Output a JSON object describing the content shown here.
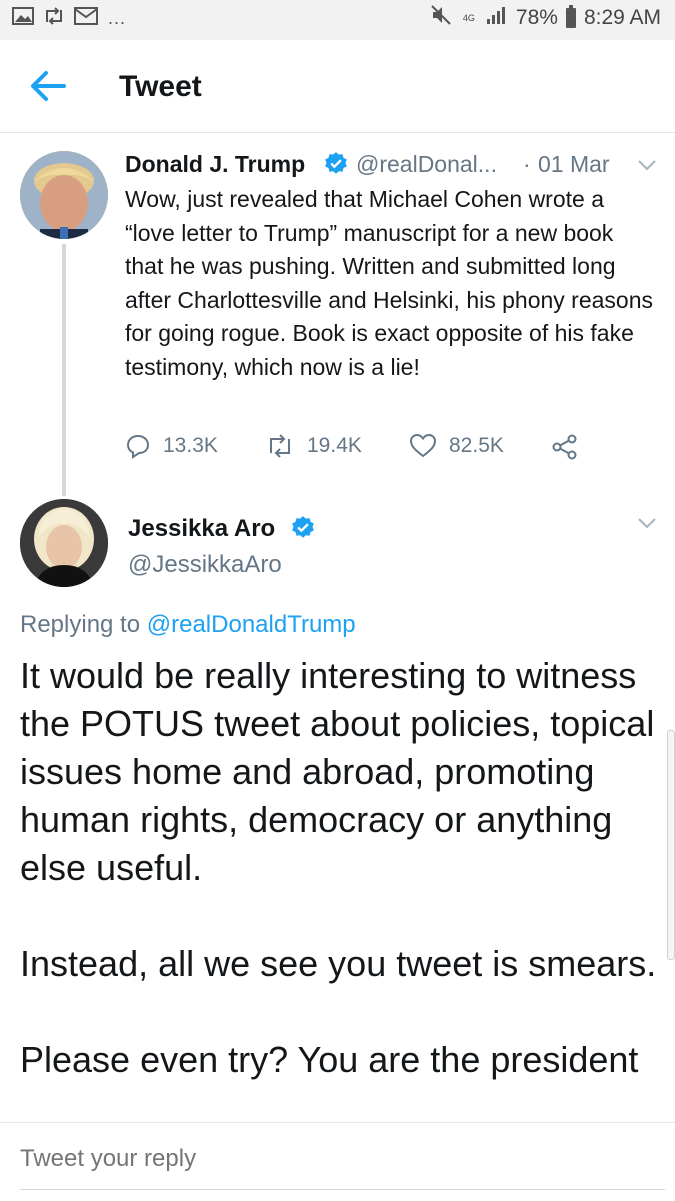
{
  "status_bar": {
    "left_icons": [
      "image-icon",
      "retweet-icon",
      "mail-icon"
    ],
    "more": "...",
    "network": "4G",
    "battery": "78%",
    "time": "8:29 AM"
  },
  "header": {
    "title": "Tweet"
  },
  "tweet": {
    "author_name": "Donald J. Trump",
    "handle": "@realDonal...",
    "separator": "·",
    "date": "01 Mar",
    "text": "Wow, just revealed that Michael Cohen wrote a “love letter to Trump” manuscript for a new book that he was pushing. Written and submitted long after Charlottesville and Helsinki, his phony reasons for going rogue. Book is exact opposite of his fake testimony, which now is a lie!",
    "replies": "13.3K",
    "retweets": "19.4K",
    "likes": "82.5K"
  },
  "reply": {
    "author_name": "Jessikka Aro",
    "handle": "@JessikkaAro",
    "replying_prefix": "Replying to ",
    "replying_to": "@realDonaldTrump",
    "paragraphs": [
      "It would be really interesting to witness the POTUS tweet about policies, topical issues home and abroad, promoting human rights, democracy or anything else useful.",
      "Instead, all we see you tweet is smears.",
      "Please even try? You are the president"
    ]
  },
  "compose": {
    "placeholder": "Tweet your reply"
  },
  "colors": {
    "accent": "#1da1f2",
    "secondary_text": "#657786",
    "primary_text": "#14171a"
  }
}
